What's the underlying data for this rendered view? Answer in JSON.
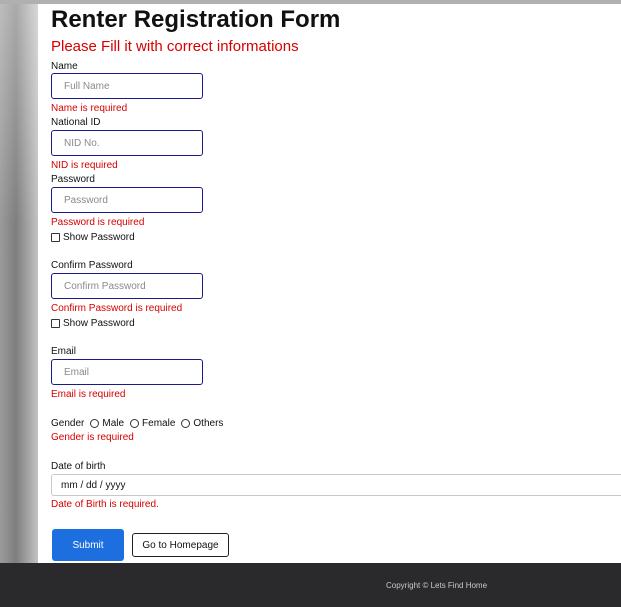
{
  "form": {
    "title": "Renter Registration Form",
    "subtitle": "Please Fill it with correct informations",
    "name": {
      "label": "Name",
      "placeholder": "Full Name",
      "error": "Name is required"
    },
    "nid": {
      "label": "National ID",
      "placeholder": "NID No.",
      "error": "NID is required"
    },
    "password": {
      "label": "Password",
      "placeholder": "Password",
      "error": "Password is required",
      "show_label": "Show Password"
    },
    "confirm": {
      "label": "Confirm Password",
      "placeholder": "Confirm Password",
      "error": "Confirm Password is required",
      "show_label": "Show Password"
    },
    "email": {
      "label": "Email",
      "placeholder": "Email",
      "error": "Email is required"
    },
    "gender": {
      "label": "Gender",
      "options": [
        "Male",
        "Female",
        "Others"
      ],
      "error": "Gender is required"
    },
    "dob": {
      "label": "Date of birth",
      "value": "mm / dd / yyyy",
      "error": "Date of Birth is required."
    },
    "submit_label": "Submit",
    "home_label": "Go to Homepage"
  },
  "footer": {
    "text": "Copyright © Lets Find Home"
  },
  "colors": {
    "accent": "#1d6fe0",
    "error": "#d60000",
    "input_border": "#1a1a8c",
    "footer_bg": "#2a2a2c"
  }
}
